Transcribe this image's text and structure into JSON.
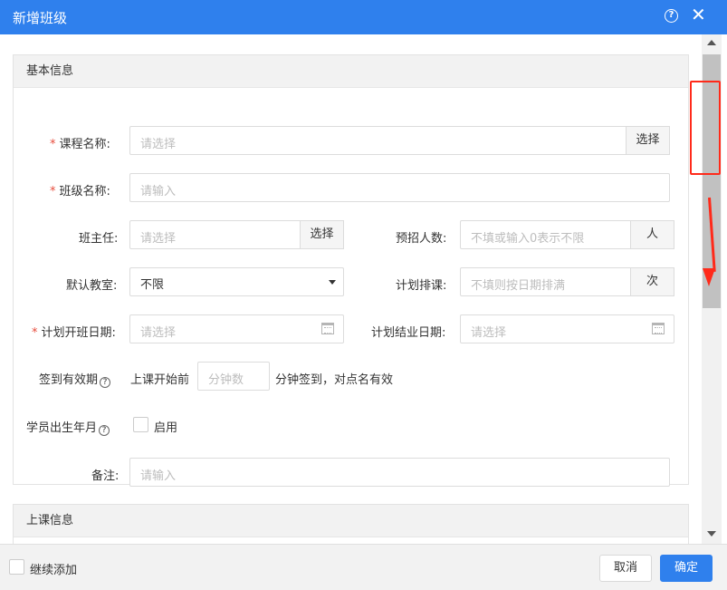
{
  "dialog": {
    "title": "新增班级",
    "help_icon": "?",
    "close_icon": "✕"
  },
  "basic": {
    "header": "基本信息",
    "course_name": {
      "label": "课程名称:",
      "required": "*",
      "placeholder": "请选择",
      "button": "选择"
    },
    "class_name": {
      "label": "班级名称:",
      "required": "*",
      "placeholder": "请输入"
    },
    "teacher": {
      "label": "班主任:",
      "placeholder": "请选择",
      "button": "选择"
    },
    "enroll_count": {
      "label": "预招人数:",
      "placeholder": "不填或输入0表示不限",
      "unit": "人"
    },
    "default_room": {
      "label": "默认教室:",
      "value": "不限"
    },
    "schedule": {
      "label": "计划排课:",
      "placeholder": "不填则按日期排满",
      "unit": "次"
    },
    "start_date": {
      "label": "计划开班日期:",
      "required": "*",
      "placeholder": "请选择"
    },
    "end_date": {
      "label": "计划结业日期:",
      "placeholder": "请选择"
    },
    "checkin": {
      "label": "签到有效期",
      "prefix": "上课开始前",
      "placeholder": "分钟数",
      "suffix": "分钟签到，对点名有效"
    },
    "birth": {
      "label": "学员出生年月",
      "option": "启用"
    },
    "remark": {
      "label": "备注:",
      "placeholder": "请输入"
    }
  },
  "class_info": {
    "header": "上课信息"
  },
  "footer": {
    "continue_label": "继续添加",
    "cancel_label": "取消",
    "ok_label": "确定"
  }
}
